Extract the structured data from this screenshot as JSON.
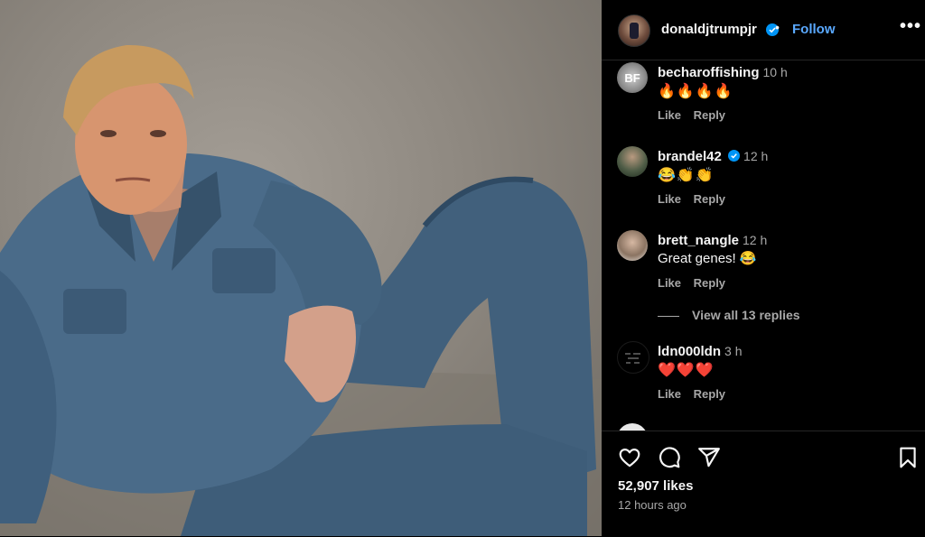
{
  "post": {
    "username": "donaldjtrumpjr",
    "follow_label": "Follow",
    "separator": "•",
    "more_label": "•••"
  },
  "comments": [
    {
      "user": "becharoffishing",
      "time": "10 h",
      "text": "🔥🔥🔥🔥",
      "like": "Like",
      "reply": "Reply",
      "avatar_text": "BF"
    },
    {
      "user": "brandel42",
      "time": "12 h",
      "text": "😂👏👏",
      "like": "Like",
      "reply": "Reply",
      "verified": true
    },
    {
      "user": "brett_nangle",
      "time": "12 h",
      "text": "Great genes! 😂",
      "like": "Like",
      "reply": "Reply"
    },
    {
      "user": "ldn000ldn",
      "time": "3 h",
      "text": "❤️❤️❤️",
      "like": "Like",
      "reply": "Reply"
    }
  ],
  "view_replies": "View all 13 replies",
  "footer": {
    "likes": "52,907 likes",
    "posted": "12 hours ago",
    "icons": [
      "heart-icon",
      "comment-icon",
      "share-icon",
      "bookmark-icon"
    ]
  },
  "colors": {
    "background": "#000000",
    "link_blue": "#5aa9ff",
    "verified_blue": "#0095f6",
    "muted_text": "#a8a8a8"
  }
}
